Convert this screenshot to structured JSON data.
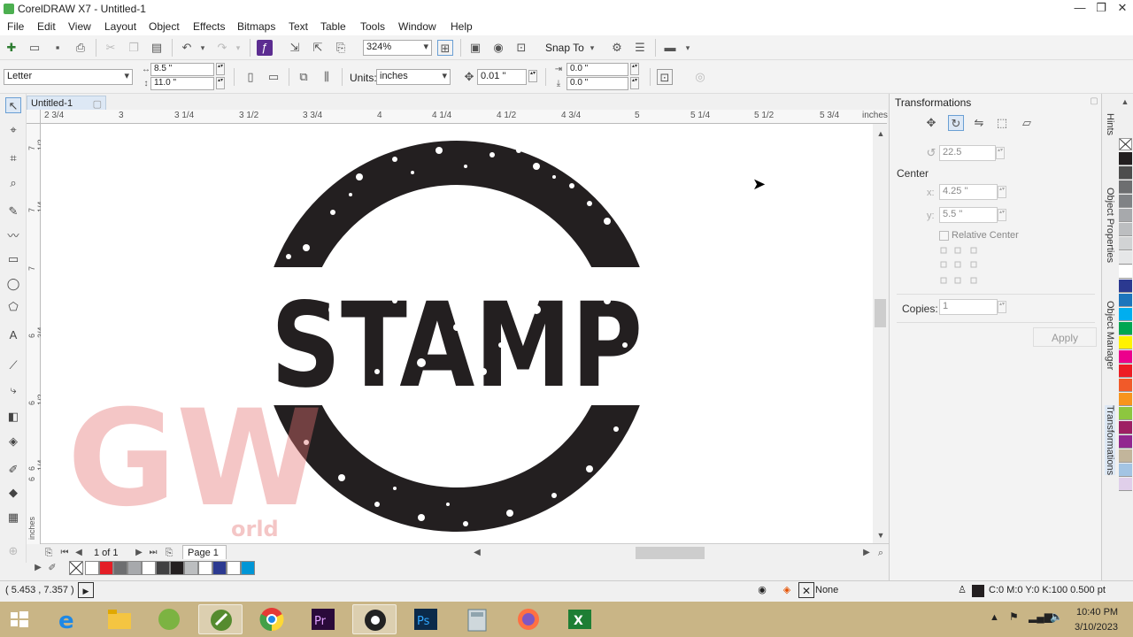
{
  "window": {
    "title": "CorelDRAW X7 - Untitled-1"
  },
  "menu": [
    "File",
    "Edit",
    "View",
    "Layout",
    "Object",
    "Effects",
    "Bitmaps",
    "Text",
    "Table",
    "Tools",
    "Window",
    "Help"
  ],
  "standard_toolbar": {
    "zoom": "324%",
    "snap_to": "Snap To"
  },
  "property_bar": {
    "page_size": "Letter",
    "width": "8.5 \"",
    "height": "11.0 \"",
    "units_label": "Units:",
    "units": "inches",
    "nudge": "0.01 \"",
    "dup_x": "0.0 \"",
    "dup_y": "0.0 \""
  },
  "document_tab": "Untitled-1",
  "ruler_top": [
    "2 3/4",
    "3",
    "3 1/4",
    "3 1/2",
    "3 3/4",
    "4",
    "4 1/4",
    "4 1/2",
    "4 3/4",
    "5",
    "5 1/4",
    "5 1/2",
    "5 3/4",
    "inches"
  ],
  "ruler_left": [
    "7 1/2",
    "7 1/4",
    "7",
    "6 3/4",
    "6 1/2",
    "6 1/4",
    "6",
    "inches"
  ],
  "canvas": {
    "stamp_text": "STAMP",
    "watermark_letters": "GW",
    "watermark_small": "orld"
  },
  "page_nav": {
    "page_count": "1 of 1",
    "page_tab": "Page 1"
  },
  "status": {
    "cursor": "( 5.453 , 7.357 )",
    "fill": "None",
    "outline": "C:0 M:0 Y:0 K:100  0.500 pt"
  },
  "docker": {
    "title": "Transformations",
    "angle": "22.5",
    "center_label": "Center",
    "x_label": "x:",
    "x": "4.25 \"",
    "y_label": "y:",
    "y": "5.5 \"",
    "relative_center": "Relative Center",
    "copies_label": "Copies:",
    "copies": "1",
    "apply": "Apply"
  },
  "docker_tabs": [
    "Hints",
    "Object Properties",
    "Object Manager",
    "Transformations"
  ],
  "taskbar": {
    "time": "10:40 PM",
    "date": "3/10/2023"
  },
  "colors": {
    "palette_bottom": [
      "#ffffff",
      "#e41e26",
      "#6d6e70",
      "#a7a9ac",
      "#ffffff",
      "#404041",
      "#231f20",
      "#bcbec0",
      "#ffffff",
      "#2b3990",
      "#ffffff",
      "#0096d6"
    ],
    "palette_right": [
      "#231f20",
      "#4d4d4d",
      "#6d6e70",
      "#808285",
      "#a7a9ac",
      "#bcbec0",
      "#d1d3d4",
      "#e6e7e8",
      "#ffffff",
      "#2b3990",
      "#1c75bc",
      "#00aeef",
      "#00a651",
      "#fff200",
      "#ec008c",
      "#ed1c24",
      "#f15a29",
      "#f7941d",
      "#8dc63f",
      "#9e1f63",
      "#92278f",
      "#c2b59b",
      "#a3c4e3",
      "#e0cfea"
    ]
  }
}
